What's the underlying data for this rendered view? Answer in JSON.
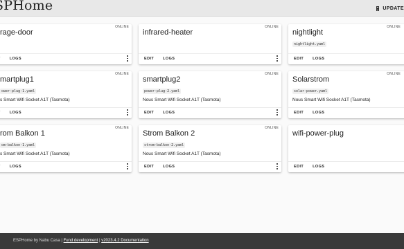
{
  "header": {
    "brand": "SPHome",
    "update_label": "UPDATE"
  },
  "devices": [
    {
      "name": "rage-door",
      "status": "ONLINE",
      "file": "",
      "description": "",
      "edit": "IT",
      "logs": "LOGS"
    },
    {
      "name": "infrared-heater",
      "status": "ONLINE",
      "file": "",
      "description": "",
      "edit": "EDIT",
      "logs": "LOGS"
    },
    {
      "name": "nightlight",
      "status": "ONLINE",
      "file": "nightlight.yaml",
      "description": "",
      "edit": "EDIT",
      "logs": "LOGS"
    },
    {
      "name": "martplug1",
      "status": "ONLINE",
      "file": "ower-plug-1.yaml",
      "description": "s Smart Wifi Socket A1T (Tasmota)",
      "edit": "IT",
      "logs": "LOGS"
    },
    {
      "name": "smartplug2",
      "status": "ONLINE",
      "file": "power-plug-2.yaml",
      "description": "Nous Smart Wifi Socket A1T (Tasmota)",
      "edit": "EDIT",
      "logs": "LOGS"
    },
    {
      "name": "Solarstrom",
      "status": "ONLINE",
      "file": "solar-power.yaml",
      "description": "Nous Smart Wifi Socket A1T (Tasmota)",
      "edit": "EDIT",
      "logs": "LOGS"
    },
    {
      "name": "rom Balkon 1",
      "status": "ONLINE",
      "file": "om-balkon-1.yaml",
      "description": "s Smart Wifi Socket A1T (Tasmota)",
      "edit": "IT",
      "logs": "LOGS"
    },
    {
      "name": "Strom Balkon 2",
      "status": "ONLINE",
      "file": "strom-balkon-2.yaml",
      "description": "Nous Smart Wifi Socket A1T (Tasmota)",
      "edit": "EDIT",
      "logs": "LOGS"
    },
    {
      "name": "wifi-power-plug",
      "status": "",
      "file": "",
      "description": "",
      "edit": "EDIT",
      "logs": "LOGS"
    }
  ],
  "footer": {
    "prefix": "ESPHome by Nabu Casa | ",
    "fund_link": "Fund development",
    "separator": " | ",
    "version_link": "v2023.4.2 Documentation"
  }
}
